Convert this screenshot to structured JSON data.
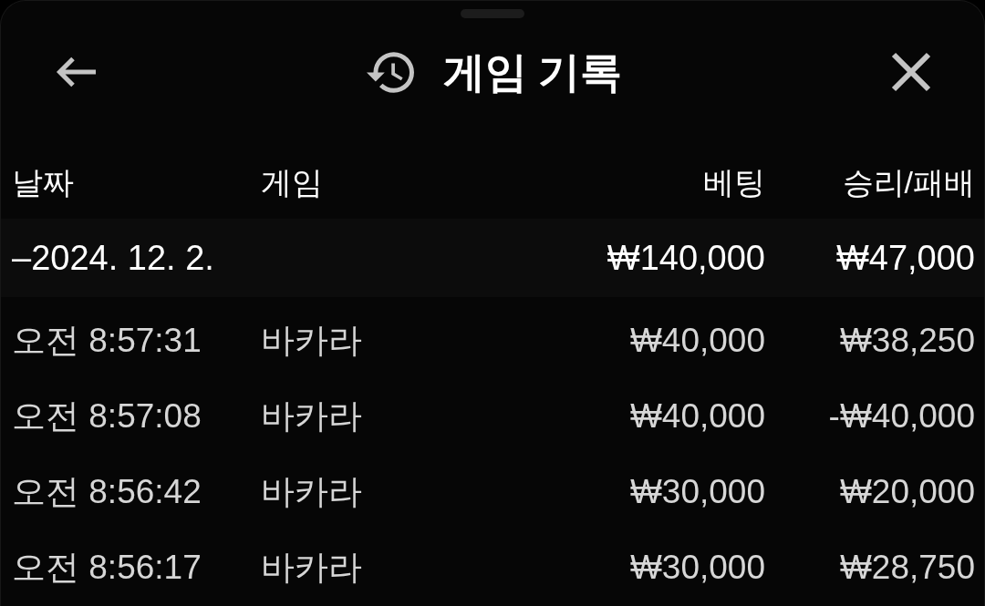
{
  "sheet": {
    "title": "게임 기록"
  },
  "table": {
    "columns": [
      "날짜",
      "게임",
      "베팅",
      "승리/패배"
    ],
    "groups": [
      {
        "date": "–2024. 12. 2.",
        "bet_total": "₩140,000",
        "result_total": "₩47,000",
        "rows": [
          {
            "time": "오전 8:57:31",
            "game": "바카라",
            "bet": "₩40,000",
            "result": "₩38,250"
          },
          {
            "time": "오전 8:57:08",
            "game": "바카라",
            "bet": "₩40,000",
            "result": "-₩40,000"
          },
          {
            "time": "오전 8:56:42",
            "game": "바카라",
            "bet": "₩30,000",
            "result": "₩20,000"
          },
          {
            "time": "오전 8:56:17",
            "game": "바카라",
            "bet": "₩30,000",
            "result": "₩28,750"
          }
        ]
      }
    ]
  }
}
